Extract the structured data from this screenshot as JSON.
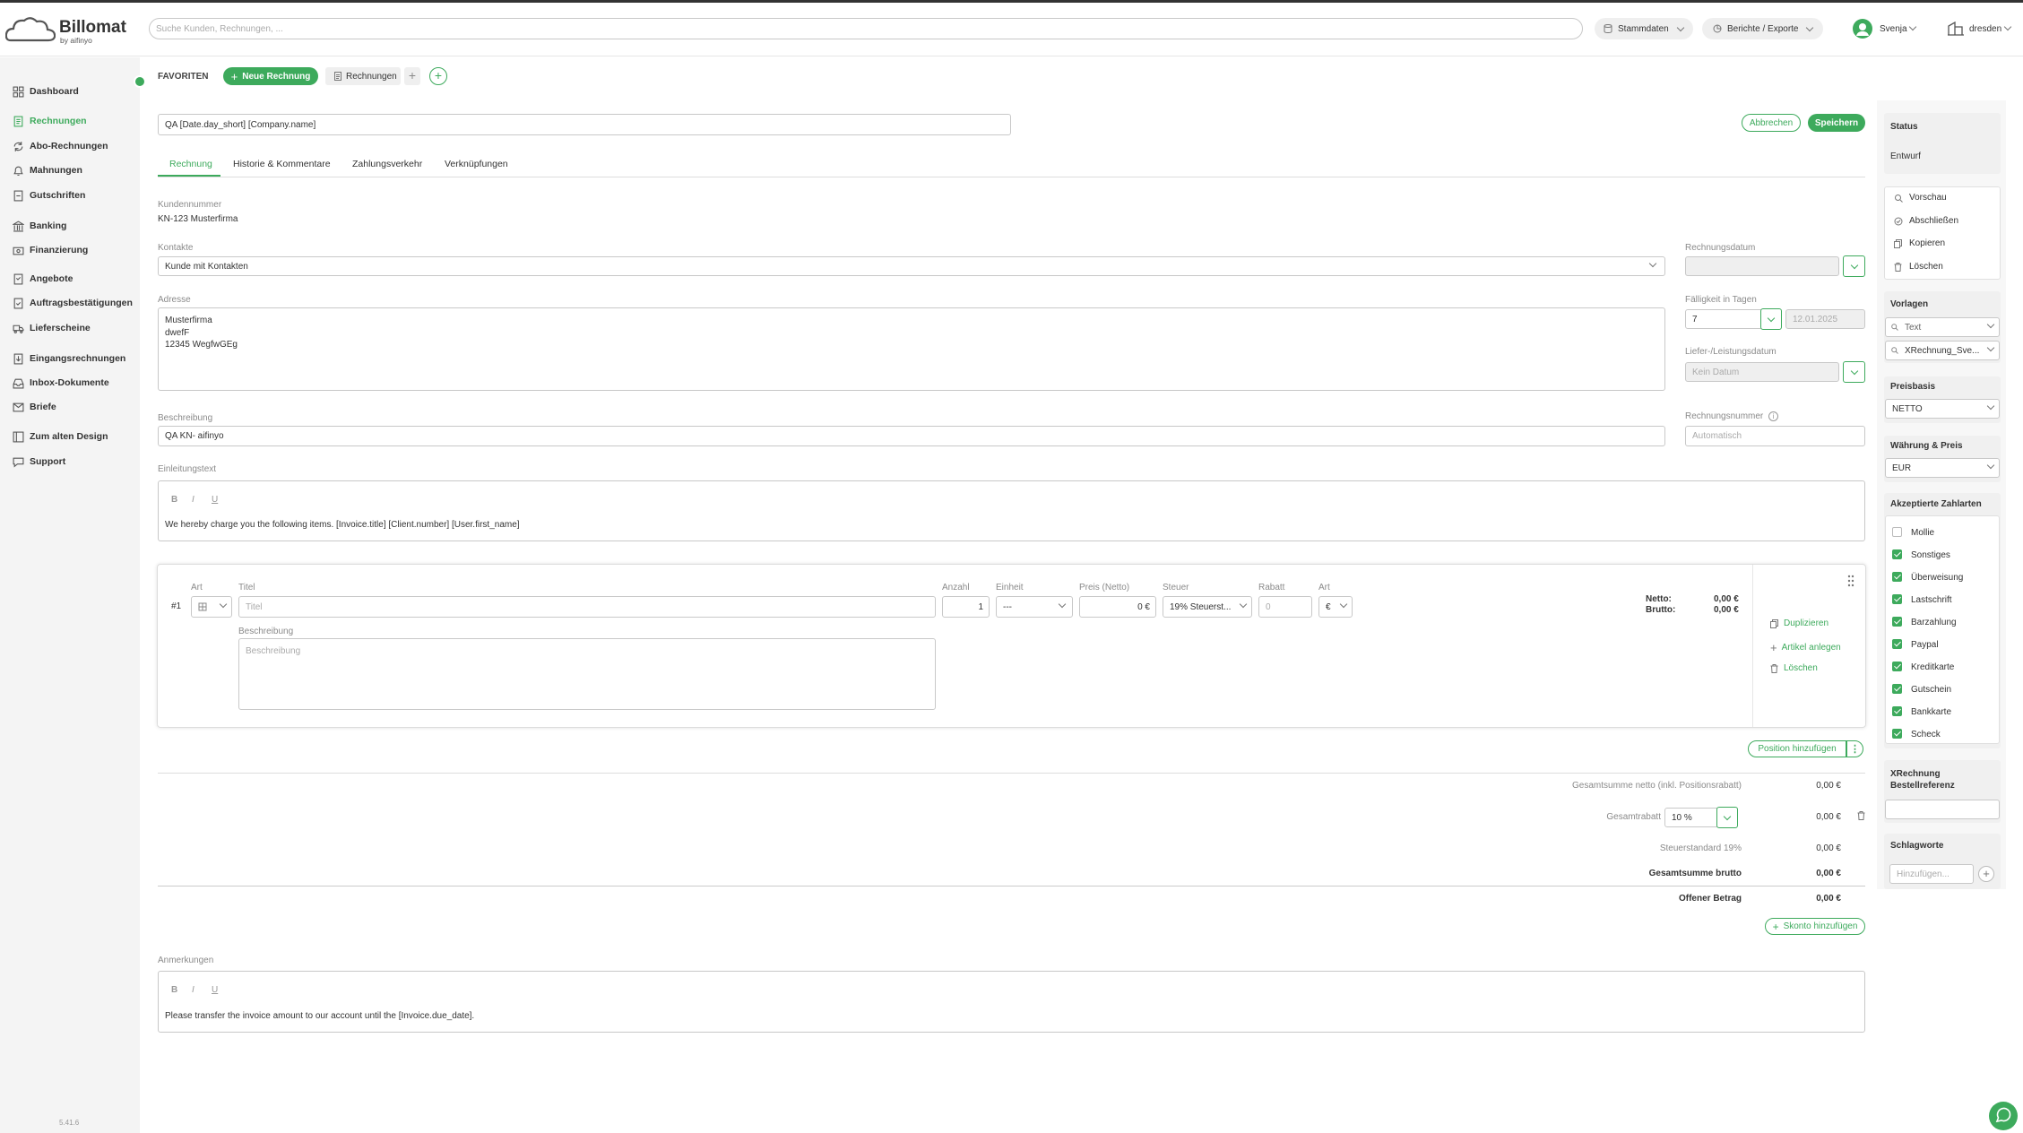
{
  "app": {
    "name": "Billomat",
    "sub": "by aifinyo",
    "version": "5.41.6"
  },
  "header": {
    "search_placeholder": "Suche Kunden, Rechnungen, ...",
    "stammdaten": "Stammdaten",
    "berichte": "Berichte / Exporte",
    "user": "Svenja",
    "company": "dresden"
  },
  "sidebar": {
    "items": [
      {
        "label": "Dashboard",
        "icon": "dashboard-icon"
      },
      {
        "label": "Rechnungen",
        "icon": "invoice-icon",
        "active": true
      },
      {
        "label": "Abo-Rechnungen",
        "icon": "recurring-icon"
      },
      {
        "label": "Mahnungen",
        "icon": "reminder-icon"
      },
      {
        "label": "Gutschriften",
        "icon": "credit-icon"
      },
      {
        "label": "Banking",
        "icon": "bank-icon"
      },
      {
        "label": "Finanzierung",
        "icon": "finance-icon"
      },
      {
        "label": "Angebote",
        "icon": "offer-icon"
      },
      {
        "label": "Auftragsbestätigungen",
        "icon": "confirmation-icon"
      },
      {
        "label": "Lieferscheine",
        "icon": "delivery-icon"
      },
      {
        "label": "Eingangsrechnungen",
        "icon": "incoming-icon"
      },
      {
        "label": "Inbox-Dokumente",
        "icon": "inbox-icon"
      },
      {
        "label": "Briefe",
        "icon": "letter-icon"
      },
      {
        "label": "Zum alten Design",
        "icon": "design-icon"
      },
      {
        "label": "Support",
        "icon": "support-icon"
      }
    ]
  },
  "favorites": {
    "label": "FAVORITEN",
    "new_invoice": "Neue Rechnung",
    "invoices": "Rechnungen"
  },
  "doc": {
    "title_value": "QA [Date.day_short] [Company.name]",
    "cancel": "Abbrechen",
    "save": "Speichern",
    "tabs": [
      "Rechnung",
      "Historie & Kommentare",
      "Zahlungsverkehr",
      "Verknüpfungen"
    ]
  },
  "form": {
    "kundennummer_label": "Kundennummer",
    "kundennummer_value": "KN-123 Musterfirma",
    "kontakte_label": "Kontakte",
    "kontakte_value": "Kunde mit Kontakten",
    "adresse_label": "Adresse",
    "adresse_lines": [
      "Musterfirma",
      "dwefF",
      "12345 WegfwGEg"
    ],
    "beschreibung_label": "Beschreibung",
    "beschreibung_value": "QA  KN- aifinyo",
    "einleitung_label": "Einleitungstext",
    "einleitung_value": "We hereby charge you the following items. [Invoice.title] [Client.number] [User.first_name]",
    "rechnungsdatum_label": "Rechnungsdatum",
    "faelligkeit_label": "Fälligkeit in Tagen",
    "faelligkeit_value": "7",
    "faelligkeit_date": "12.01.2025",
    "lieferdatum_label": "Liefer-/Leistungsdatum",
    "lieferdatum_placeholder": "Kein Datum",
    "rechnungsnummer_label": "Rechnungsnummer",
    "rechnungsnummer_placeholder": "Automatisch"
  },
  "position": {
    "number": "#1",
    "art_label": "Art",
    "titel_label": "Titel",
    "titel_placeholder": "Titel",
    "anzahl_label": "Anzahl",
    "anzahl_value": "1",
    "einheit_label": "Einheit",
    "einheit_value": "---",
    "preis_label": "Preis (Netto)",
    "preis_value": "0 €",
    "steuer_label": "Steuer",
    "steuer_value": "19% Steuerst...",
    "rabatt_label": "Rabatt",
    "rabatt_placeholder": "0",
    "art2_label": "Art",
    "art2_value": "€",
    "beschreibung_label": "Beschreibung",
    "beschreibung_placeholder": "Beschreibung",
    "netto_label": "Netto:",
    "netto_value": "0,00 €",
    "brutto_label": "Brutto:",
    "brutto_value": "0,00 €",
    "actions": [
      "Duplizieren",
      "Artikel anlegen",
      "Löschen"
    ],
    "add_position": "Position hinzufügen"
  },
  "totals": {
    "netto_label": "Gesamtsumme netto (inkl. Positionsrabatt)",
    "netto_value": "0,00 €",
    "rabatt_label": "Gesamtrabatt",
    "rabatt_input": "10 %",
    "rabatt_value": "0,00 €",
    "steuer_label": "Steuerstandard 19%",
    "steuer_value": "0,00 €",
    "brutto_label": "Gesamtsumme brutto",
    "brutto_value": "0,00 €",
    "offen_label": "Offener Betrag",
    "offen_value": "0,00 €",
    "skonto": "Skonto hinzufügen"
  },
  "notes": {
    "label": "Anmerkungen",
    "value": "Please transfer the invoice amount to our account until the [Invoice.due_date]."
  },
  "right": {
    "status_title": "Status",
    "status_value": "Entwurf",
    "actions": [
      "Vorschau",
      "Abschließen",
      "Kopieren",
      "Löschen"
    ],
    "vorlagen_title": "Vorlagen",
    "vorlage_text": "Text",
    "vorlage_xr": "XRechnung_Sve...",
    "preisbasis_title": "Preisbasis",
    "preisbasis_value": "NETTO",
    "waehrung_title": "Währung & Preis",
    "waehrung_value": "EUR",
    "zahlarten_title": "Akzeptierte Zahlarten",
    "zahlarten": [
      {
        "label": "Mollie",
        "checked": false
      },
      {
        "label": "Sonstiges",
        "checked": true
      },
      {
        "label": "Überweisung",
        "checked": true
      },
      {
        "label": "Lastschrift",
        "checked": true
      },
      {
        "label": "Barzahlung",
        "checked": true
      },
      {
        "label": "Paypal",
        "checked": true
      },
      {
        "label": "Kreditkarte",
        "checked": true
      },
      {
        "label": "Gutschein",
        "checked": true
      },
      {
        "label": "Bankkarte",
        "checked": true
      },
      {
        "label": "Scheck",
        "checked": true
      }
    ],
    "xrechnung_title1": "XRechnung",
    "xrechnung_title2": "Bestellreferenz",
    "schlagworte_title": "Schlagworte",
    "schlagworte_placeholder": "Hinzufügen..."
  },
  "colors": {
    "accent": "#3daa5c",
    "sidebar_bg": "#f4f4f4"
  }
}
